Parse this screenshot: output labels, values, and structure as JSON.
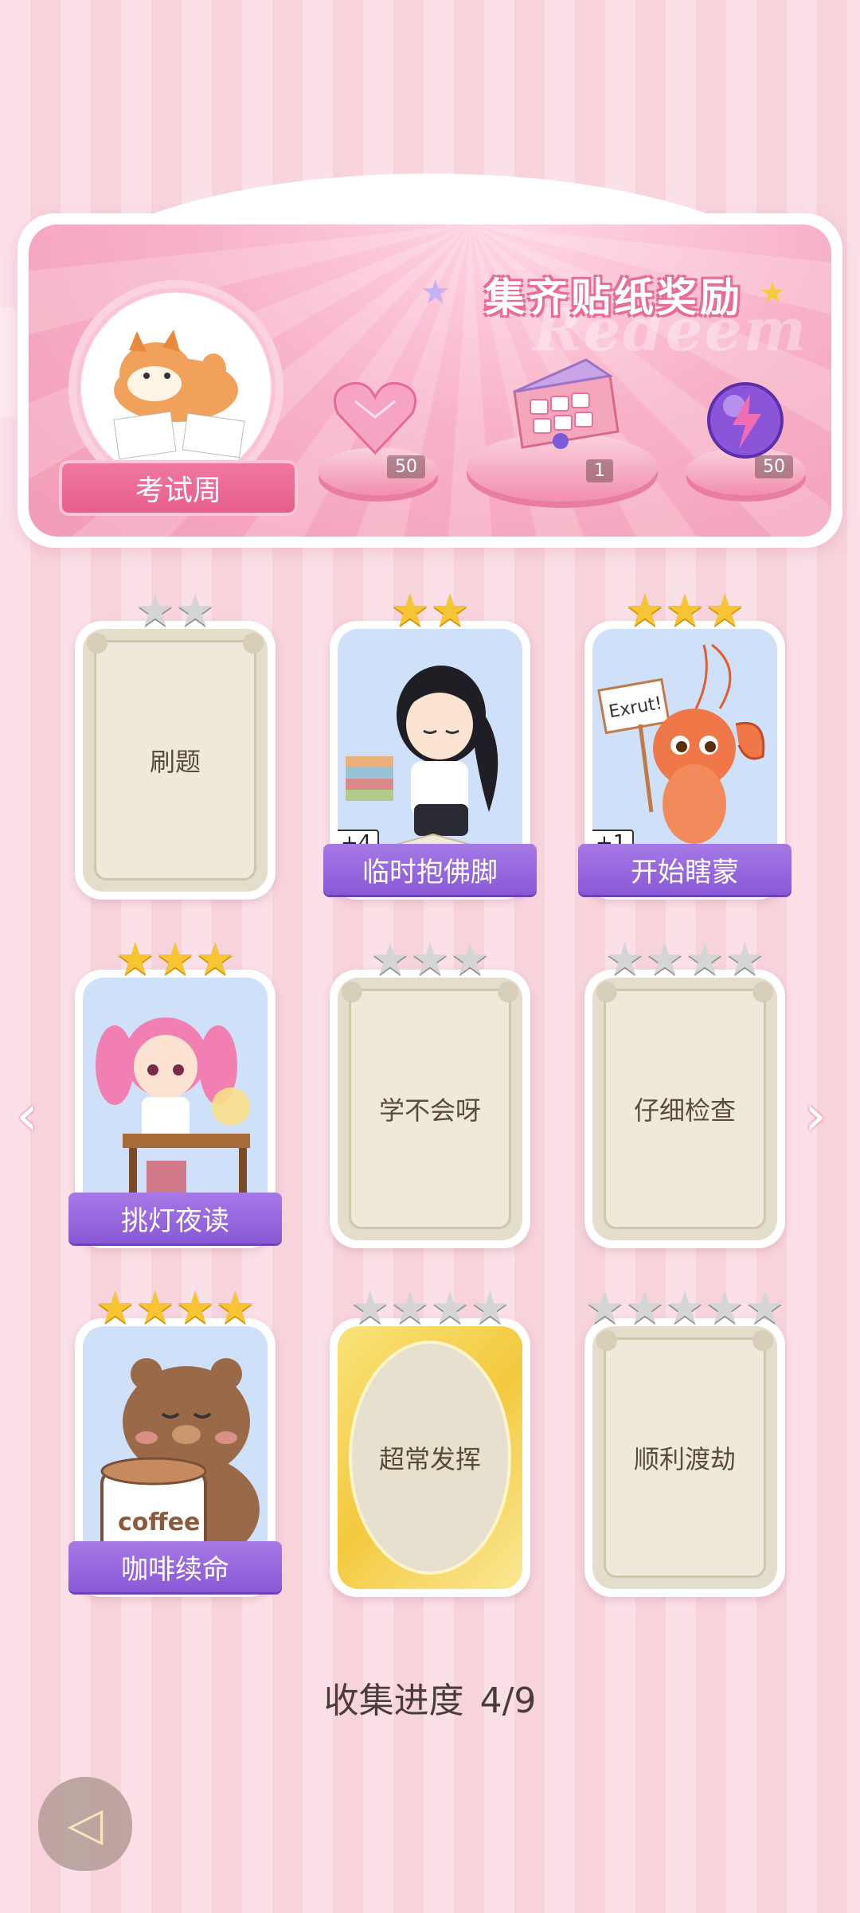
{
  "header": {
    "title": "集齐贴纸奖励",
    "watermark": "Redeem",
    "theme_label": "考试周",
    "rewards": [
      {
        "icon": "pink-heart-gem-icon",
        "count": "50"
      },
      {
        "icon": "gift-box-icon",
        "count": "1"
      },
      {
        "icon": "purple-lightning-orb-icon",
        "count": "50"
      }
    ]
  },
  "cards": [
    {
      "label": "刷题",
      "stars": 2,
      "unlocked": false,
      "style": "plain"
    },
    {
      "label": "临时抱佛脚",
      "stars": 2,
      "unlocked": true,
      "bonus": "+4",
      "art": "sleepy-girl-studying"
    },
    {
      "label": "开始瞎蒙",
      "stars": 3,
      "unlocked": true,
      "bonus": "+1",
      "art": "shrimp-with-sign",
      "sign_text": "Exrut!"
    },
    {
      "label": "挑灯夜读",
      "stars": 3,
      "unlocked": true,
      "art": "pink-hair-girl-desk"
    },
    {
      "label": "学不会呀",
      "stars": 3,
      "unlocked": false,
      "style": "plain"
    },
    {
      "label": "仔细检查",
      "stars": 4,
      "unlocked": false,
      "style": "plain"
    },
    {
      "label": "咖啡续命",
      "stars": 4,
      "unlocked": true,
      "art": "bear-with-coffee",
      "cup_text": "coffee"
    },
    {
      "label": "超常发挥",
      "stars": 4,
      "unlocked": false,
      "style": "gold"
    },
    {
      "label": "顺利渡劫",
      "stars": 5,
      "unlocked": false,
      "style": "plain"
    }
  ],
  "progress": {
    "label": "收集进度",
    "value": "4/9"
  },
  "nav": {
    "prev_icon": "chevron-left-icon",
    "next_icon": "chevron-right-icon",
    "back_icon": "back-arrow-icon"
  }
}
